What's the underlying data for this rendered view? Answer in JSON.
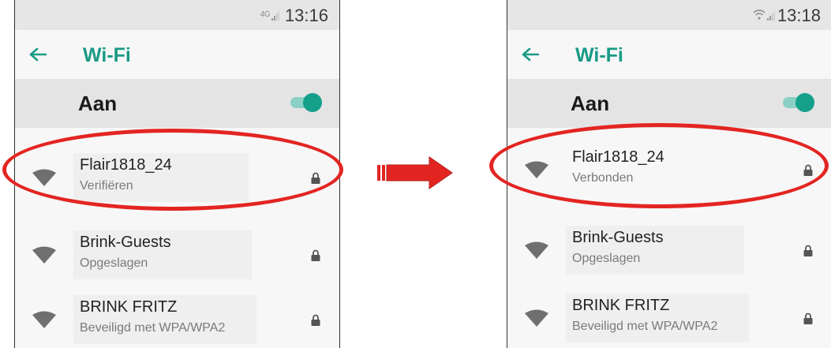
{
  "colors": {
    "accent": "#1a9a86",
    "annotation_red": "#e32522"
  },
  "screens": [
    {
      "status": {
        "time": "13:16",
        "network": "4G",
        "network_icon": "signal-bars-icon"
      },
      "appbar": {
        "title": "Wi-Fi",
        "back_icon": "arrow-left-icon"
      },
      "switch": {
        "label": "Aan",
        "on": true
      },
      "networks": [
        {
          "ssid": "Flair1818_24",
          "status": "Verifiëren",
          "icon": "wifi-icon",
          "secured_icon": "lock-icon"
        },
        {
          "ssid": "Brink-Guests",
          "status": "Opgeslagen",
          "icon": "wifi-icon",
          "secured_icon": "lock-icon"
        },
        {
          "ssid": "BRINK FRITZ",
          "status": "Beveiligd met WPA/WPA2",
          "icon": "wifi-icon",
          "secured_icon": "lock-icon"
        }
      ]
    },
    {
      "status": {
        "time": "13:18",
        "network_icon": "wifi-signal-icon"
      },
      "appbar": {
        "title": "Wi-Fi",
        "back_icon": "arrow-left-icon"
      },
      "switch": {
        "label": "Aan",
        "on": true
      },
      "networks": [
        {
          "ssid": "Flair1818_24",
          "status": "Verbonden",
          "icon": "wifi-icon",
          "secured_icon": "lock-icon"
        },
        {
          "ssid": "Brink-Guests",
          "status": "Opgeslagen",
          "icon": "wifi-icon",
          "secured_icon": "lock-icon"
        },
        {
          "ssid": "BRINK FRITZ",
          "status": "Beveiligd met WPA/WPA2",
          "icon": "wifi-icon",
          "secured_icon": "lock-icon"
        }
      ]
    }
  ]
}
